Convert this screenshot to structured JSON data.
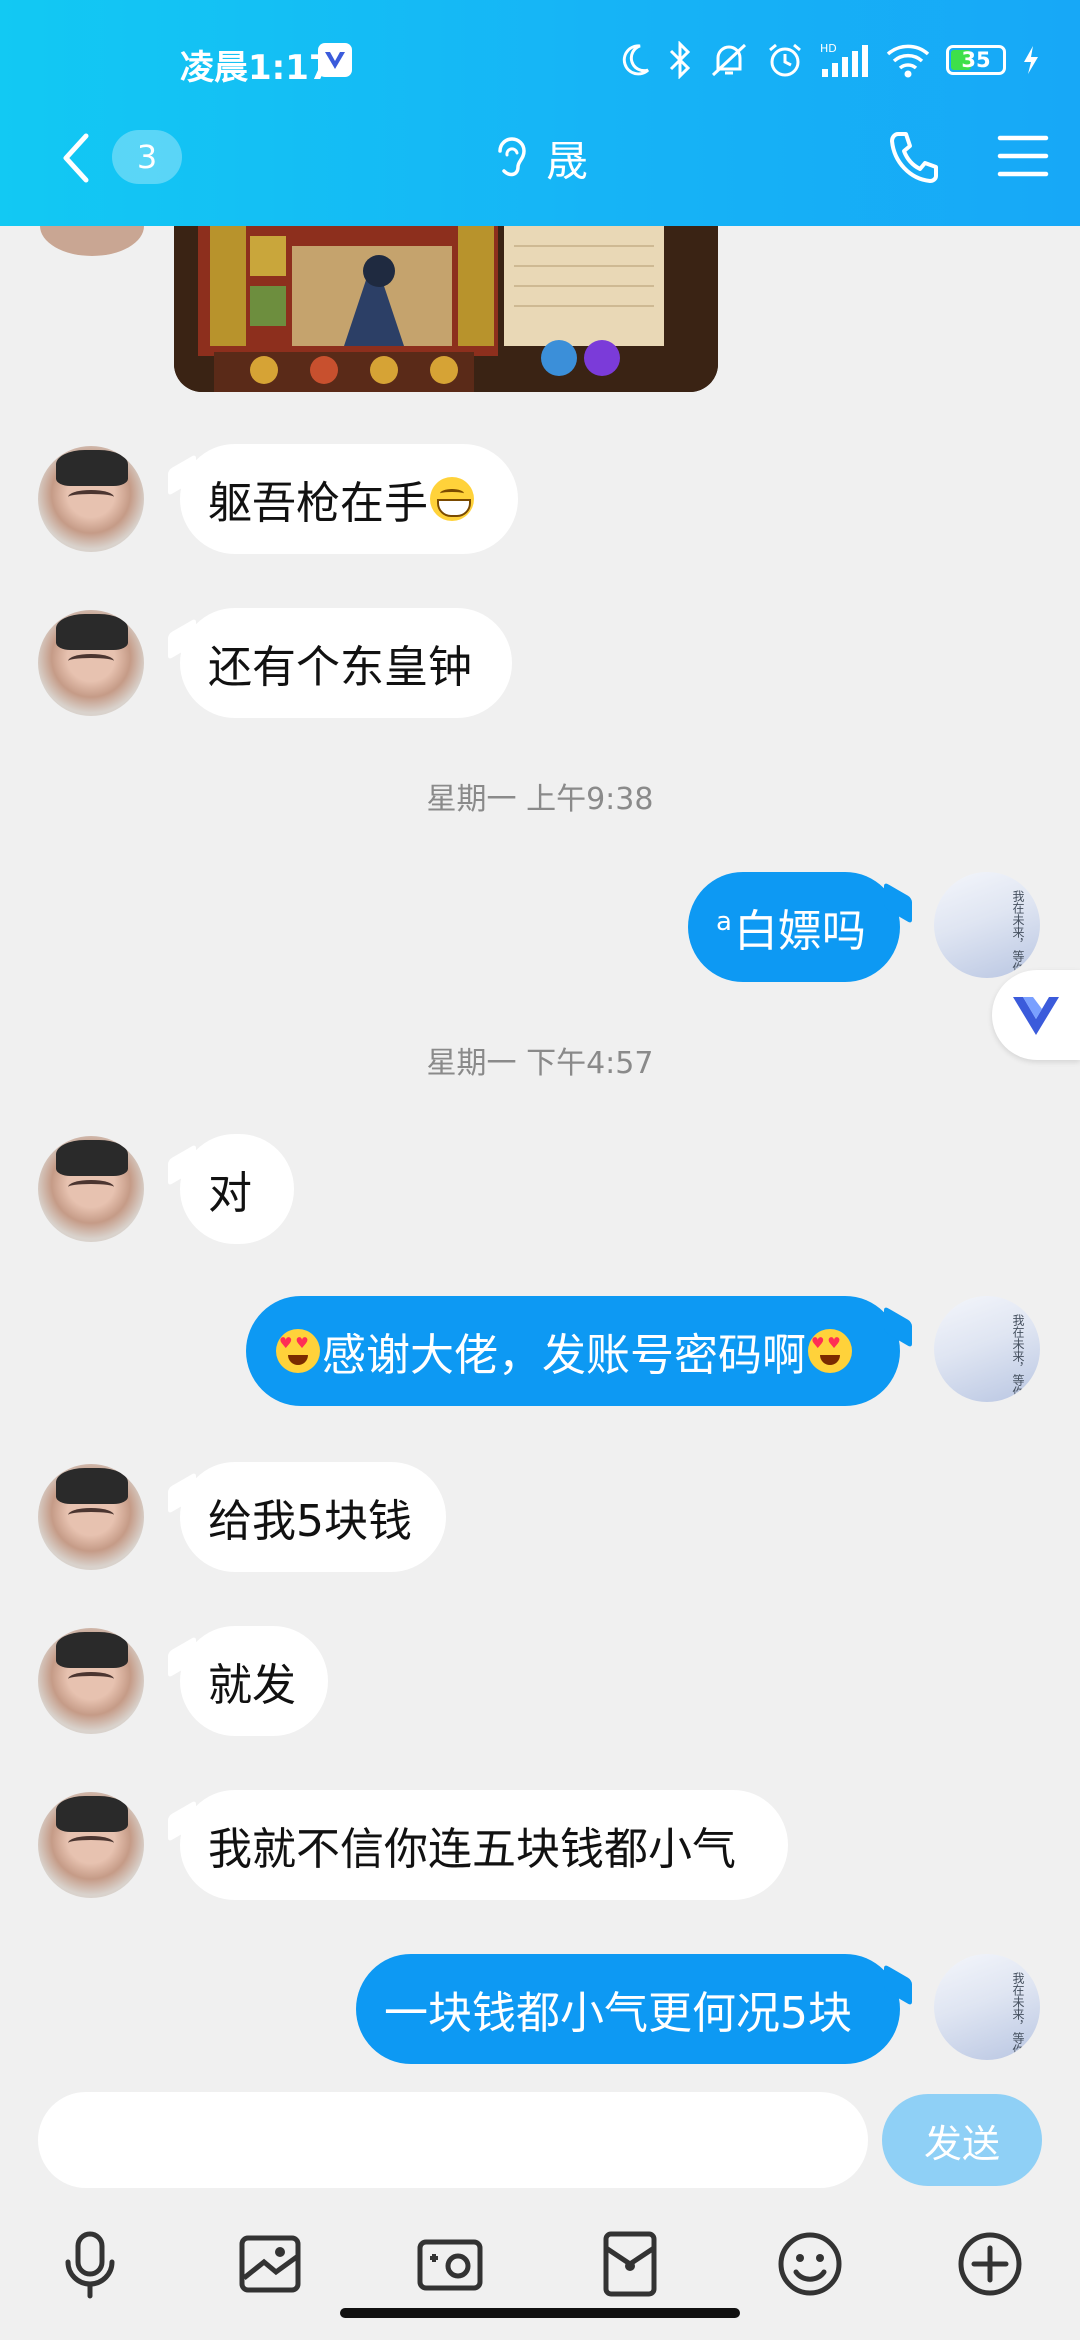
{
  "status_bar": {
    "time": "凌晨1:17",
    "battery": "35"
  },
  "nav": {
    "unread_count": "3",
    "title": "晟"
  },
  "messages": [
    {
      "side": "in",
      "text": "躯吾枪在手",
      "emoji": "grin"
    },
    {
      "side": "in",
      "text": "还有个东皇钟"
    },
    {
      "type": "time",
      "text": "星期一 上午9:38"
    },
    {
      "side": "out",
      "sup": "a",
      "text": "白嫖吗"
    },
    {
      "type": "time",
      "text": "星期一 下午4:57"
    },
    {
      "side": "in",
      "text": "对"
    },
    {
      "side": "out",
      "text": "感谢大佬，发账号密码啊",
      "emoji": "heart-eyes"
    },
    {
      "side": "in",
      "text": "给我5块钱"
    },
    {
      "side": "in",
      "text": "就发"
    },
    {
      "side": "in",
      "text": "我就不信你连五块钱都小气"
    },
    {
      "side": "out",
      "text": "一块钱都小气更何况5块"
    }
  ],
  "my_avatar_text": "我在未来，等你",
  "input": {
    "placeholder": "",
    "value": "",
    "send_label": "发送"
  },
  "toolbar": [
    "microphone-icon",
    "image-icon",
    "camera-icon",
    "red-packet-icon",
    "emoji-icon",
    "plus-icon"
  ],
  "colors": {
    "header_start": "#12c9f3",
    "header_end": "#17a8f7",
    "outgoing_bubble": "#0d99f3",
    "incoming_bubble": "#ffffff",
    "background": "#f0f0f0",
    "send_button": "#8fd0f6"
  }
}
